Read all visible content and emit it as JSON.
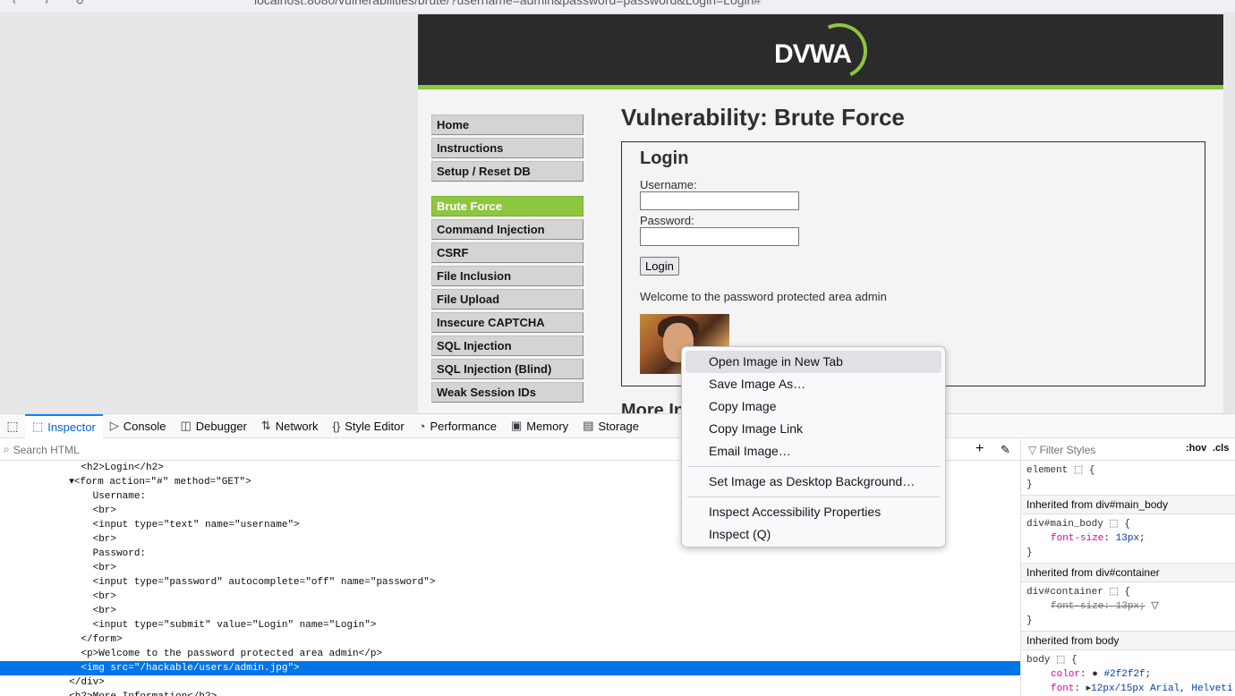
{
  "browser": {
    "url": "localhost:8080/vulnerabilities/brute/?username=admin&password=password&Login=Login#"
  },
  "dvwa": {
    "logo": "DVWA",
    "menu_group1": [
      "Home",
      "Instructions",
      "Setup / Reset DB"
    ],
    "menu_group2": [
      "Brute Force",
      "Command Injection",
      "CSRF",
      "File Inclusion",
      "File Upload",
      "Insecure CAPTCHA",
      "SQL Injection",
      "SQL Injection (Blind)",
      "Weak Session IDs"
    ],
    "active_item": "Brute Force",
    "page_title": "Vulnerability: Brute Force",
    "login_heading": "Login",
    "username_label": "Username:",
    "password_label": "Password:",
    "login_button": "Login",
    "welcome_text": "Welcome to the password protected area admin",
    "more_info": "More Information"
  },
  "devtools": {
    "tabs": [
      "Inspector",
      "Console",
      "Debugger",
      "Network",
      "Style Editor",
      "Performance",
      "Memory",
      "Storage"
    ],
    "selected_tab": "Inspector",
    "search_placeholder": "Search HTML",
    "filter_placeholder": "Filter Styles",
    "hov_label": ":hov",
    "cls_label": ".cls",
    "markup_lines": [
      "    <h2>Login</h2>",
      "  ▾<form action=\"#\" method=\"GET\">",
      "      Username:",
      "      <br>",
      "      <input type=\"text\" name=\"username\">",
      "      <br>",
      "      Password:",
      "      <br>",
      "      <input type=\"password\" autocomplete=\"off\" name=\"password\">",
      "      <br>",
      "      <br>",
      "      <input type=\"submit\" value=\"Login\" name=\"Login\">",
      "    </form>",
      "    <p>Welcome to the password protected area admin</p>",
      "    <img src=\"/hackable/users/admin.jpg\">",
      "  </div>",
      "  <h2>More Information</h2>"
    ],
    "selected_line_index": 14,
    "styles": {
      "element_rule": "element",
      "inherited_main_body": "Inherited from div#main_body",
      "main_body_selector": "div#main_body",
      "main_body_prop": "font-size",
      "main_body_value": "13px",
      "inherited_container": "Inherited from div#container",
      "container_selector": "div#container",
      "container_prop_struck": "font-size: 13px;",
      "inherited_body": "Inherited from body",
      "body_selector": "body",
      "body_color_prop": "color",
      "body_color_value": "#2f2f2f",
      "body_font_prop": "font",
      "body_font_value": "12px/15px Arial, Helveti"
    }
  },
  "context_menu": {
    "items": [
      "Open Image in New Tab",
      "Save Image As…",
      "Copy Image",
      "Copy Image Link",
      "Email Image…"
    ],
    "set_bg": "Set Image as Desktop Background…",
    "inspect_items": [
      "Inspect Accessibility Properties",
      "Inspect (Q)"
    ],
    "highlighted": "Open Image in New Tab"
  },
  "colors": {
    "dvwa_green": "#8dc63f",
    "header_dark": "#2b2b2b",
    "devtools_blue": "#0074e8"
  }
}
